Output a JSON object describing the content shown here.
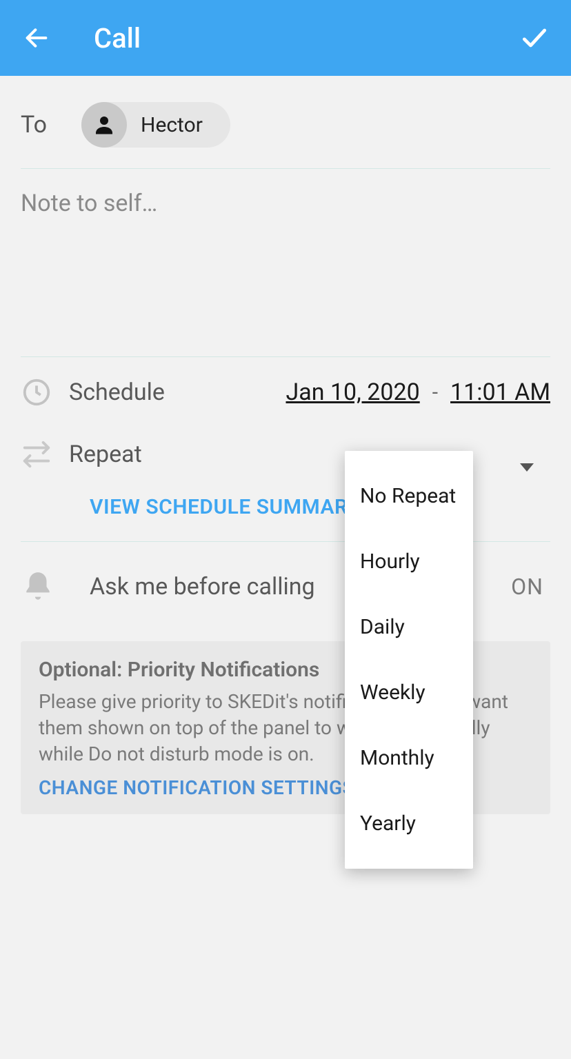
{
  "header": {
    "title": "Call"
  },
  "to": {
    "label": "To",
    "contact": "Hector"
  },
  "note": {
    "placeholder": "Note to self…"
  },
  "schedule": {
    "label": "Schedule",
    "date": "Jan 10, 2020",
    "dash": "-",
    "time": "11:01 AM"
  },
  "repeat": {
    "label": "Repeat",
    "options": [
      "No Repeat",
      "Hourly",
      "Daily",
      "Weekly",
      "Monthly",
      "Yearly"
    ]
  },
  "summary_link": "VIEW SCHEDULE SUMMARY",
  "ask": {
    "label": "Ask me before calling",
    "state": "ON"
  },
  "priority_card": {
    "title": "Optional: Priority Notifications",
    "body": "Please give priority to SKEDit's notifications if you want them shown on top of the panel to work successfully while Do not disturb mode is on.",
    "link": "CHANGE NOTIFICATION SETTINGS"
  }
}
